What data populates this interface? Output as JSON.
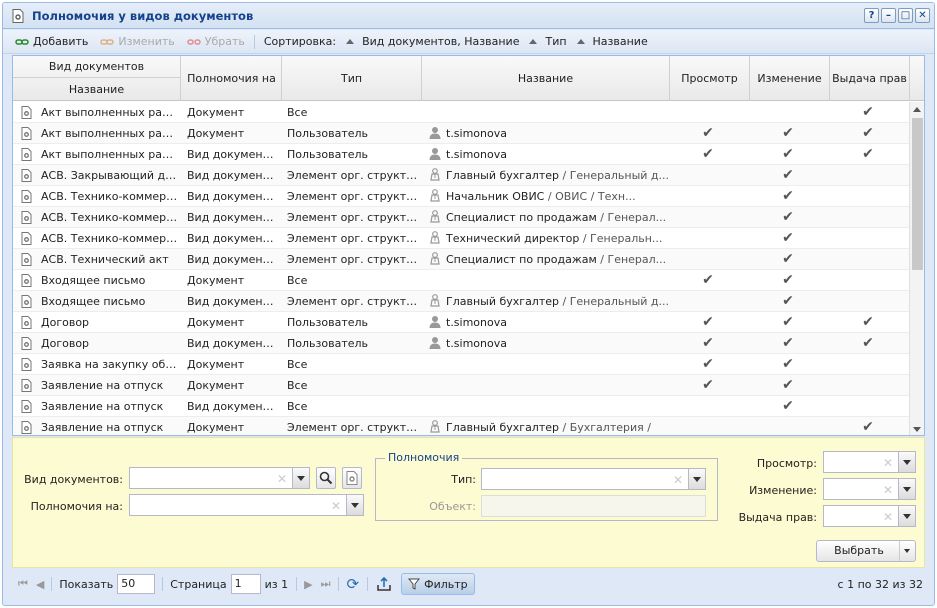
{
  "window": {
    "title": "Полномочия у видов документов"
  },
  "toolbar": {
    "add": "Добавить",
    "edit": "Изменить",
    "remove": "Убрать",
    "sort_label": "Сортировка:",
    "sort1": "Вид документов, Название",
    "sort2": "Тип",
    "sort3": "Название"
  },
  "grid": {
    "headers": {
      "doc_kind": "Вид документов",
      "name": "Название",
      "authority_on": "Полномочия на",
      "type": "Тип",
      "title": "Название",
      "view": "Просмотр",
      "change": "Изменение",
      "grant": "Выдача прав"
    },
    "rows": [
      {
        "name": "Акт выполненных работ",
        "on": "Документ",
        "type": "Все",
        "icon": "",
        "main": "",
        "rest": "",
        "view": false,
        "change": false,
        "grant": true
      },
      {
        "name": "Акт выполненных работ",
        "on": "Документ",
        "type": "Пользователь",
        "icon": "user-icon",
        "main": "t.simonova",
        "rest": "",
        "view": true,
        "change": true,
        "grant": true
      },
      {
        "name": "Акт выполненных работ",
        "on": "Вид документов",
        "type": "Пользователь",
        "icon": "user-icon",
        "main": "t.simonova",
        "rest": "",
        "view": true,
        "change": true,
        "grant": true
      },
      {
        "name": "АСВ. Закрывающий доку...",
        "on": "Вид документов",
        "type": "Элемент орг. структуры",
        "icon": "position-icon",
        "main": "Главный бухгалтер",
        "rest": " / Генеральный д...",
        "view": false,
        "change": true,
        "grant": false
      },
      {
        "name": "АСВ. Технико-коммерче...",
        "on": "Вид документов",
        "type": "Элемент орг. структуры",
        "icon": "position-icon",
        "main": "Начальник ОВИС",
        "rest": " / ОВИС / Техн...",
        "view": false,
        "change": true,
        "grant": false
      },
      {
        "name": "АСВ. Технико-коммерче...",
        "on": "Вид документов",
        "type": "Элемент орг. структуры",
        "icon": "position-icon",
        "main": "Специалист по продажам",
        "rest": " / Генерал...",
        "view": false,
        "change": true,
        "grant": false
      },
      {
        "name": "АСВ. Технико-коммерче...",
        "on": "Вид документов",
        "type": "Элемент орг. структуры",
        "icon": "position-icon",
        "main": "Технический директор",
        "rest": " / Генеральн...",
        "view": false,
        "change": true,
        "grant": false
      },
      {
        "name": "АСВ. Технический акт",
        "on": "Вид документов",
        "type": "Элемент орг. структуры",
        "icon": "position-icon",
        "main": "Специалист по продажам",
        "rest": " / Генерал...",
        "view": false,
        "change": true,
        "grant": false
      },
      {
        "name": "Входящее письмо",
        "on": "Документ",
        "type": "Все",
        "icon": "",
        "main": "",
        "rest": "",
        "view": true,
        "change": true,
        "grant": false
      },
      {
        "name": "Входящее письмо",
        "on": "Вид документов",
        "type": "Элемент орг. структуры",
        "icon": "position-icon",
        "main": "Главный бухгалтер",
        "rest": " / Генеральный д...",
        "view": false,
        "change": true,
        "grant": false
      },
      {
        "name": "Договор",
        "on": "Документ",
        "type": "Пользователь",
        "icon": "user-icon",
        "main": "t.simonova",
        "rest": "",
        "view": true,
        "change": true,
        "grant": true
      },
      {
        "name": "Договор",
        "on": "Вид документов",
        "type": "Пользователь",
        "icon": "user-icon",
        "main": "t.simonova",
        "rest": "",
        "view": true,
        "change": true,
        "grant": true
      },
      {
        "name": "Заявка на закупку обору...",
        "on": "Документ",
        "type": "Все",
        "icon": "",
        "main": "",
        "rest": "",
        "view": true,
        "change": true,
        "grant": false
      },
      {
        "name": "Заявление на отпуск",
        "on": "Документ",
        "type": "Все",
        "icon": "",
        "main": "",
        "rest": "",
        "view": true,
        "change": true,
        "grant": false
      },
      {
        "name": "Заявление на отпуск",
        "on": "Вид документов",
        "type": "Все",
        "icon": "",
        "main": "",
        "rest": "",
        "view": false,
        "change": true,
        "grant": false
      },
      {
        "name": "Заявление на отпуск",
        "on": "Документ",
        "type": "Элемент орг. структуры",
        "icon": "position-icon",
        "main": "Главный бухгалтер",
        "rest": " / Бухгалтерия /",
        "view": false,
        "change": false,
        "grant": true
      }
    ]
  },
  "filter": {
    "doc_kind_label": "Вид документов:",
    "authority_on_label": "Полномочия на:",
    "group_label": "Полномочия",
    "type_label": "Тип:",
    "object_label": "Объект:",
    "view_label": "Просмотр:",
    "change_label": "Изменение:",
    "grant_label": "Выдача прав:",
    "pick_button": "Выбрать"
  },
  "pager": {
    "show_label": "Показать",
    "page_size": "50",
    "page_label": "Страница",
    "page": "1",
    "of_pages": "из 1",
    "filter_button": "Фильтр",
    "info": "с 1 по 32 из 32"
  }
}
